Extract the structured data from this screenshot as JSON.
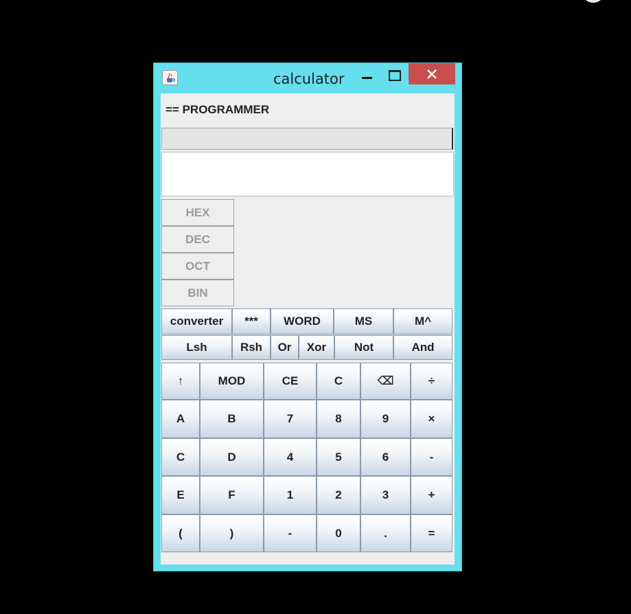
{
  "window": {
    "title": "calculator",
    "colors": {
      "frame": "#65dfee",
      "close": "#c94f4f",
      "client": "#eeeeee"
    }
  },
  "mode_label": "== PROGRAMMER",
  "expression_value": "",
  "result_value": "",
  "bases": [
    "HEX",
    "DEC",
    "OCT",
    "BIN"
  ],
  "func_row1": [
    "converter",
    "***",
    "WORD",
    "MS",
    "M^"
  ],
  "func_row2": [
    "Lsh",
    "Rsh",
    "Or",
    "Xor",
    "Not",
    "And"
  ],
  "keypad": [
    [
      "↑",
      "MOD",
      "CE",
      "C",
      "⌫",
      "÷"
    ],
    [
      "A",
      "B",
      "7",
      "8",
      "9",
      "×"
    ],
    [
      "C",
      "D",
      "4",
      "5",
      "6",
      "-"
    ],
    [
      "E",
      "F",
      "1",
      "2",
      "3",
      "+"
    ],
    [
      "(",
      ")",
      "-",
      "0",
      ".",
      "="
    ]
  ],
  "icons": {
    "app": "java-coffee-icon",
    "minimize": "minimize-icon",
    "maximize": "maximize-icon",
    "close": "close-icon"
  }
}
